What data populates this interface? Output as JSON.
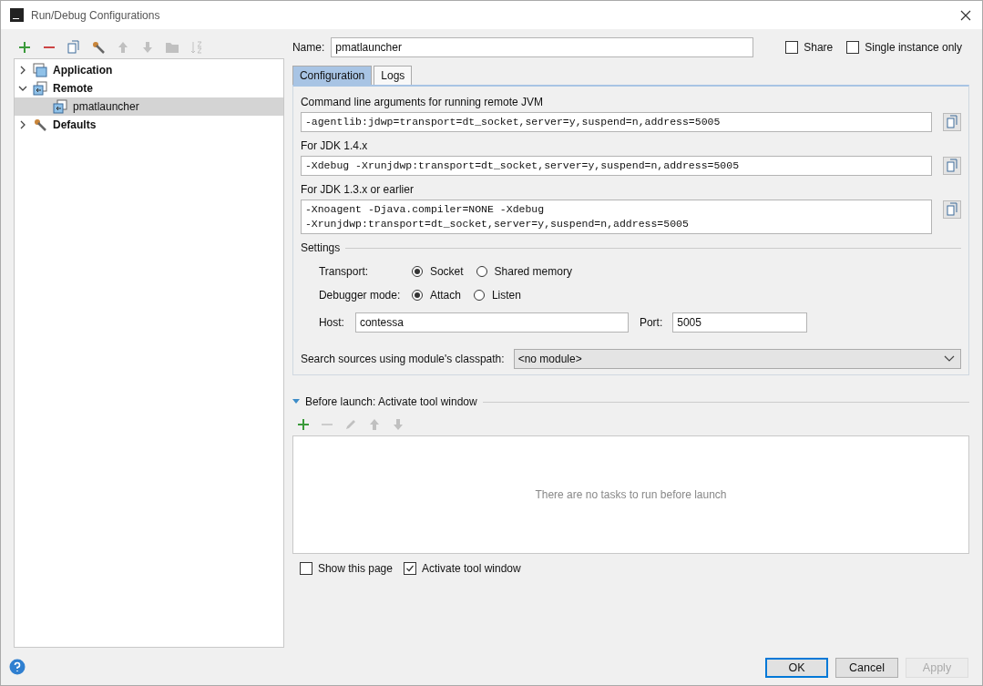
{
  "window": {
    "title": "Run/Debug Configurations"
  },
  "toolbar": [
    {
      "kind": "add",
      "disabled": false
    },
    {
      "kind": "remove",
      "disabled": false
    },
    {
      "kind": "copy",
      "disabled": false
    },
    {
      "kind": "wrench",
      "disabled": false
    },
    {
      "kind": "up",
      "disabled": true
    },
    {
      "kind": "down",
      "disabled": true
    },
    {
      "kind": "folder",
      "disabled": true
    },
    {
      "kind": "sort",
      "disabled": true
    }
  ],
  "tree": [
    {
      "label": "Application",
      "kind": "application",
      "expanded": false,
      "selected": false
    },
    {
      "label": "Remote",
      "kind": "remote",
      "expanded": true,
      "selected": false,
      "children": [
        {
          "label": "pmatlauncher",
          "kind": "remote",
          "selected": true
        }
      ]
    },
    {
      "label": "Defaults",
      "kind": "defaults",
      "expanded": false,
      "selected": false
    }
  ],
  "name": {
    "label": "Name:",
    "value": "pmatlauncher"
  },
  "share": {
    "label": "Share",
    "checked": false
  },
  "single_instance": {
    "label": "Single instance only",
    "checked": false
  },
  "tabs": [
    {
      "label": "Configuration",
      "selected": true
    },
    {
      "label": "Logs",
      "selected": false
    }
  ],
  "arguments": [
    {
      "label": "Command line arguments for running remote JVM",
      "value": "-agentlib:jdwp=transport=dt_socket,server=y,suspend=n,address=5005"
    },
    {
      "label": "For JDK 1.4.x",
      "value": "-Xdebug -Xrunjdwp:transport=dt_socket,server=y,suspend=n,address=5005"
    },
    {
      "label": "For JDK 1.3.x or earlier",
      "value": "-Xnoagent -Djava.compiler=NONE -Xdebug\n-Xrunjdwp:transport=dt_socket,server=y,suspend=n,address=5005"
    }
  ],
  "settings": {
    "title": "Settings",
    "radio_groups": [
      {
        "label": "Transport:",
        "options": [
          {
            "label": "Socket",
            "selected": true
          },
          {
            "label": "Shared memory",
            "selected": false
          }
        ]
      },
      {
        "label": "Debugger mode:",
        "options": [
          {
            "label": "Attach",
            "selected": true
          },
          {
            "label": "Listen",
            "selected": false
          }
        ]
      }
    ],
    "host": {
      "label": "Host:",
      "value": "contessa"
    },
    "port": {
      "label": "Port:",
      "value": "5005"
    },
    "module": {
      "label": "Search sources using module's classpath:",
      "value": "<no module>"
    }
  },
  "before_launch": {
    "title": "Before launch: Activate tool window",
    "expanded": true,
    "toolbar": [
      {
        "kind": "add",
        "disabled": false
      },
      {
        "kind": "remove",
        "disabled": true
      },
      {
        "kind": "edit",
        "disabled": true
      },
      {
        "kind": "up",
        "disabled": true
      },
      {
        "kind": "down",
        "disabled": true
      }
    ],
    "empty_text": "There are no tasks to run before launch",
    "options": [
      {
        "label": "Show this page",
        "checked": false
      },
      {
        "label": "Activate tool window",
        "checked": true
      }
    ]
  },
  "buttons": [
    {
      "label": "OK",
      "kind": "default",
      "disabled": false
    },
    {
      "label": "Cancel",
      "kind": "normal",
      "disabled": false
    },
    {
      "label": "Apply",
      "kind": "normal",
      "disabled": true
    }
  ]
}
